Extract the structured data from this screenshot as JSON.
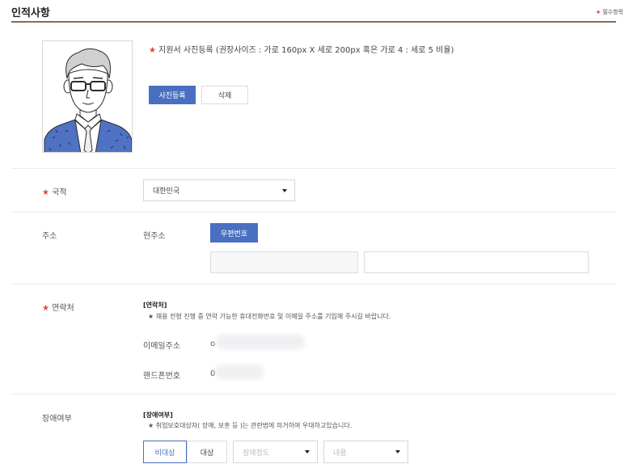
{
  "header": {
    "title": "인적사항",
    "required_label": "필수항목"
  },
  "photo": {
    "note": "지원서 사진등록 (권장사이즈 : 가로 160px X 세로 200px 혹은 가로 4 : 세로 5 비율)",
    "register_label": "사진등록",
    "delete_label": "삭제"
  },
  "nationality": {
    "label": "국적",
    "value": "대한민국"
  },
  "address": {
    "label": "주소",
    "current_label": "현주소",
    "zip_label": "우편번호"
  },
  "contact": {
    "label": "연락처",
    "heading": "[연락처]",
    "note": "★ 채용 전형 진행 중 연락 가능한 휴대전화번호 및 이메일 주소를 기입해 주시길 바랍니다.",
    "email_label": "이메일주소",
    "email_prefix": "o",
    "phone_label": "핸드폰번호",
    "phone_prefix": "0"
  },
  "disability": {
    "label": "장애여부",
    "heading": "[장애여부]",
    "note": "★ 취업보호대상자( 장애, 보훈 등 )는 관련법에 의거하여 우대하고있습니다.",
    "non_target_label": "비대상",
    "target_label": "대상",
    "degree_placeholder": "장애정도",
    "content_placeholder": "내용"
  },
  "colors": {
    "accent": "#4a6fc1",
    "required_star": "#e8413c",
    "header_line": "#8b6a4e"
  }
}
